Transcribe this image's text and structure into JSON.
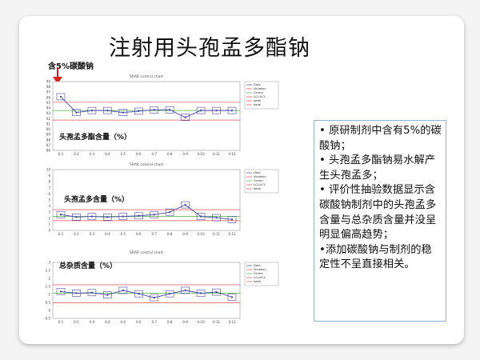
{
  "slide": {
    "title": "注射用头孢孟多酯钠",
    "marker_label": "含5%碳酸钠"
  },
  "charts": [
    {
      "id": "chart1",
      "header": "SRAR control chart",
      "inner_label": "头孢孟多酯含量（%）",
      "y_ticks": [
        "99",
        "98",
        "97",
        "96",
        "95",
        "94",
        "93",
        "92",
        "91",
        "90",
        "89",
        "88",
        "87",
        "86"
      ],
      "x_ticks": [
        "0-1",
        "0-2",
        "0-3",
        "0-4",
        "0-5",
        "0-6",
        "0-7",
        "0-8",
        "0-9",
        "0-10",
        "0-11",
        "0-12"
      ],
      "legend": [
        "Data",
        "Violation",
        "Center",
        "LCL/UCL",
        "datal",
        "datal"
      ]
    },
    {
      "id": "chart2",
      "header": "SRAR control chart",
      "inner_label": "头孢孟多含量（%）",
      "y_ticks": [
        "10",
        "9",
        "8",
        "7",
        "6",
        "5",
        "4",
        "3",
        "2",
        "1",
        "0"
      ],
      "x_ticks": [
        "0-1",
        "0-2",
        "0-3",
        "0-4",
        "0-5",
        "0-6",
        "0-7",
        "0-8",
        "0-9",
        "0-10",
        "0-11",
        "0-12"
      ],
      "legend": [
        "Data",
        "Violation",
        "Center",
        "LCL/UCL",
        "datal"
      ]
    },
    {
      "id": "chart3",
      "header": "SRAR control chart",
      "inner_label": "总杂质含量（%）",
      "y_ticks": [
        "3",
        "2.5",
        "2",
        "1.5",
        "1",
        "0.5",
        "0",
        "-0.5"
      ],
      "x_ticks": [
        "0-1",
        "0-2",
        "0-3",
        "0-4",
        "0-5",
        "0-6",
        "0-7",
        "0-8",
        "0-9",
        "0-10",
        "0-11",
        "0-12"
      ],
      "legend": [
        "Data",
        "Violation",
        "Center",
        "LCL/UCL",
        "datal"
      ]
    }
  ],
  "notes": [
    "• 原研制剂中含有5%的碳酸钠；",
    "• 头孢孟多酯钠易水解产生头孢孟多；",
    "• 评价性抽验数据显示含碳酸钠制剂中的头孢孟多含量与总杂质含量并没呈明显偏高趋势；",
    "•添加碳酸钠与制剂的稳定性不呈直接相关。"
  ],
  "colors": {
    "arrow": "#e02020",
    "data_line": "#4a4aa8",
    "ucl_line": "#e05050",
    "center_line": "#50b050",
    "box_border": "#8fb4d8"
  }
}
